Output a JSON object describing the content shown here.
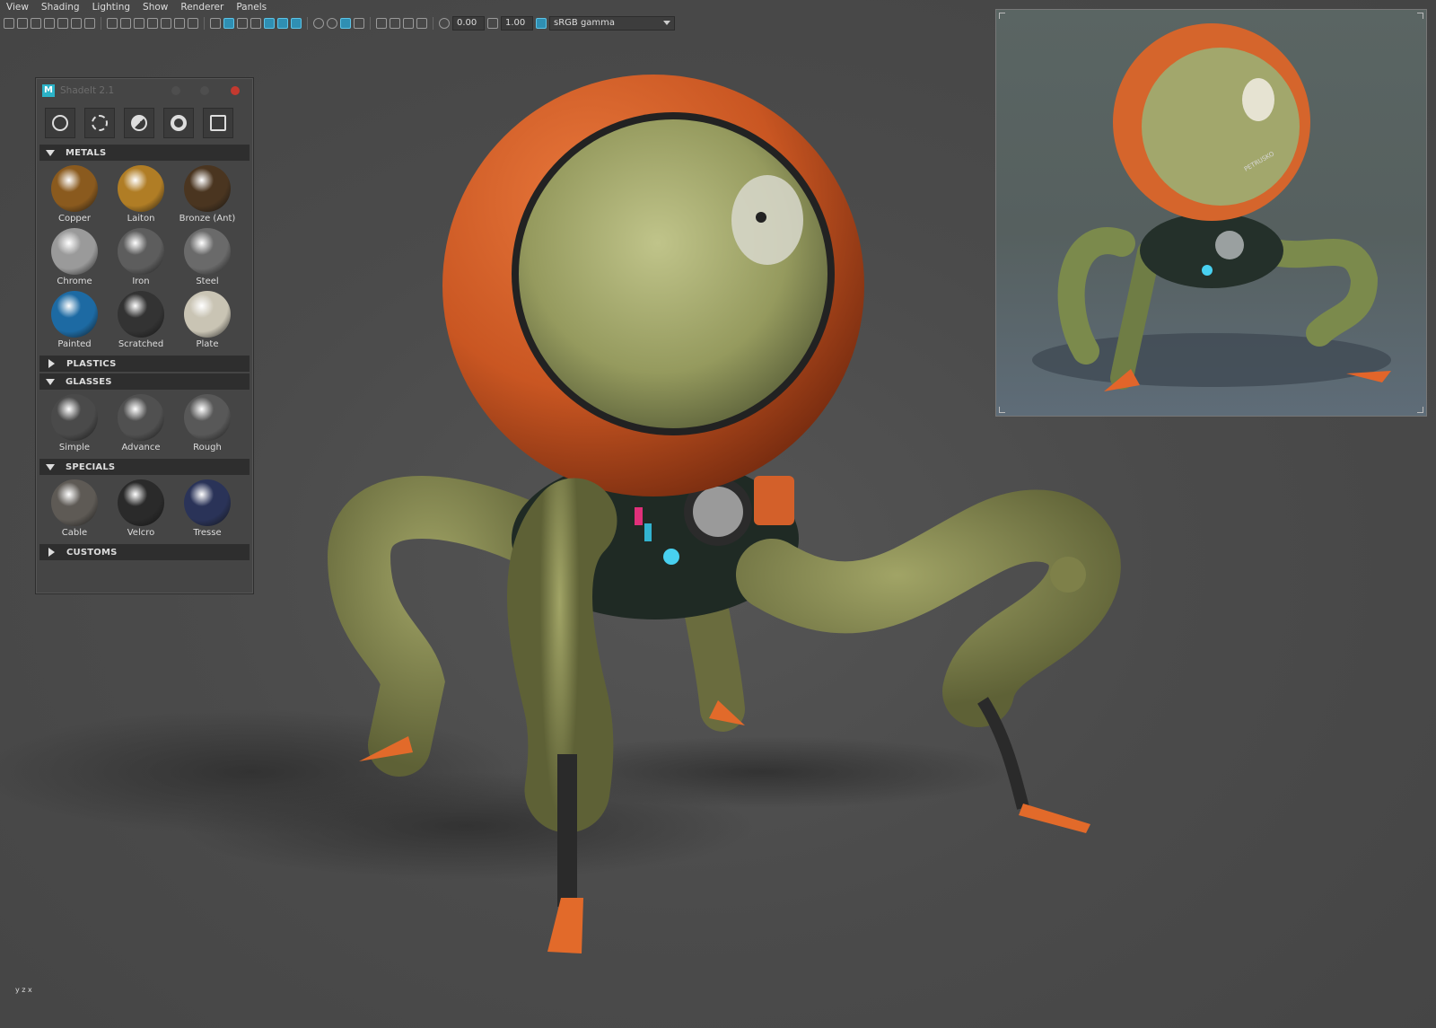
{
  "menu": [
    "View",
    "Shading",
    "Lighting",
    "Show",
    "Renderer",
    "Panels"
  ],
  "toolbar": {
    "exposure": "0.00",
    "gamma": "1.00",
    "color_space": "sRGB gamma"
  },
  "panel": {
    "title": "ShadeIt 2.1",
    "logo": "M",
    "tools": [
      "shader-ball-icon",
      "light-rig-icon",
      "sphere-half-icon",
      "camera-lens-icon",
      "cube-grid-icon"
    ]
  },
  "sections": [
    {
      "name": "METALS",
      "expanded": true,
      "items": [
        {
          "label": "Copper",
          "color": "#8a5a1e"
        },
        {
          "label": "Laiton",
          "color": "#b07d25"
        },
        {
          "label": "Bronze (Ant)",
          "color": "#4a3520"
        },
        {
          "label": "Chrome",
          "color": "#9a9a9a"
        },
        {
          "label": "Iron",
          "color": "#5d5d5d"
        },
        {
          "label": "Steel",
          "color": "#6a6a6a"
        },
        {
          "label": "Painted",
          "color": "#1d6aa3"
        },
        {
          "label": "Scratched",
          "color": "#333333"
        },
        {
          "label": "Plate",
          "color": "#c9c4b4"
        }
      ]
    },
    {
      "name": "PLASTICS",
      "expanded": false,
      "items": []
    },
    {
      "name": "GLASSES",
      "expanded": true,
      "items": [
        {
          "label": "Simple",
          "color": "#4a4a4a"
        },
        {
          "label": "Advance",
          "color": "#505050"
        },
        {
          "label": "Rough",
          "color": "#585858"
        }
      ]
    },
    {
      "name": "SPECIALS",
      "expanded": true,
      "items": [
        {
          "label": "Cable",
          "color": "#5e5a55"
        },
        {
          "label": "Velcro",
          "color": "#2a2a2a"
        },
        {
          "label": "Tresse",
          "color": "#2a3358"
        }
      ]
    },
    {
      "name": "CUSTOMS",
      "expanded": false,
      "items": []
    }
  ],
  "reference": {
    "text_on_helmet": "PETRUSKO"
  },
  "axis_label": "y z x",
  "colors": {
    "accent": "#2f8fb3",
    "helmet_orange": "#d9622a",
    "visor_green": "#9ea26a",
    "body_olive": "#8a8c52",
    "close_red": "#c3392f"
  }
}
